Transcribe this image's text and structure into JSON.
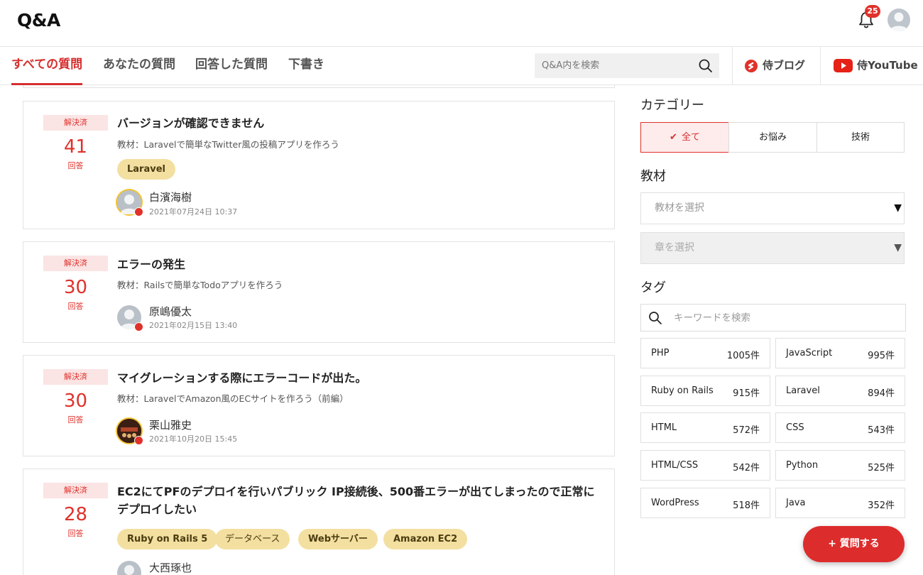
{
  "header": {
    "logo": "Q&A",
    "notification_count": "25"
  },
  "nav": {
    "tabs": [
      {
        "label": "すべての質問",
        "active": true
      },
      {
        "label": "あなたの質問"
      },
      {
        "label": "回答した質問"
      },
      {
        "label": "下書き"
      }
    ],
    "search_placeholder": "Q&A内を検索",
    "blog_label": "侍ブログ",
    "youtube_label": "侍YouTube"
  },
  "questions": [
    {
      "status": "解決済",
      "answers": "41",
      "answers_label": "回答",
      "title": "バージョンが確認できません",
      "material": "教材：Laravelで簡単なTwitter風の投稿アプリを作ろう",
      "tags": [
        "Laravel"
      ],
      "author": "白濱海樹",
      "date": "2021年07月24日 10:37"
    },
    {
      "status": "解決済",
      "answers": "30",
      "answers_label": "回答",
      "title": "エラーの発生",
      "material": "教材：Railsで簡単なTodoアプリを作ろう",
      "tags": [],
      "author": "原嶋優太",
      "date": "2021年02月15日 13:40"
    },
    {
      "status": "解決済",
      "answers": "30",
      "answers_label": "回答",
      "title": "マイグレーションする際にエラーコードが出た。",
      "material": "教材：LaravelでAmazon風のECサイトを作ろう（前編）",
      "tags": [],
      "author": "栗山雅史",
      "date": "2021年10月20日 15:45"
    },
    {
      "status": "解決済",
      "answers": "28",
      "answers_label": "回答",
      "title": "EC2にてPFのデプロイを行いパブリック IP接続後、500番エラーが出てしまったので正常にデプロイしたい",
      "material": "",
      "tags": [
        "Ruby on Rails 5",
        "データベース",
        "Webサーバー",
        "Amazon EC2"
      ],
      "author": "大西琢也",
      "date": ""
    }
  ],
  "sidebar": {
    "category_heading": "カテゴリー",
    "categories": [
      {
        "label": "全て",
        "active": true
      },
      {
        "label": "お悩み"
      },
      {
        "label": "技術"
      }
    ],
    "material_heading": "教材",
    "material_select": "教材を選択",
    "chapter_select": "章を選択",
    "tag_heading": "タグ",
    "tag_search_placeholder": "キーワードを検索",
    "tags": [
      {
        "name": "PHP",
        "count": "1005件"
      },
      {
        "name": "JavaScript",
        "count": "995件"
      },
      {
        "name": "Ruby on Rails",
        "count": "915件"
      },
      {
        "name": "Laravel",
        "count": "894件"
      },
      {
        "name": "HTML",
        "count": "572件"
      },
      {
        "name": "CSS",
        "count": "543件"
      },
      {
        "name": "HTML/CSS",
        "count": "542件"
      },
      {
        "name": "Python",
        "count": "525件"
      },
      {
        "name": "WordPress",
        "count": "518件"
      },
      {
        "name": "Java",
        "count": "352件"
      }
    ]
  },
  "ask_button": "+ 質問する",
  "colors": {
    "accent": "#d62f2f",
    "badge_bg": "#fbe4e4",
    "tag_chip": "#f3dfa0"
  }
}
